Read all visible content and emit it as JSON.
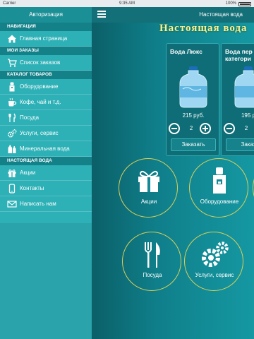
{
  "status_bar": {
    "carrier": "Carrier",
    "time": "9:35 AM",
    "battery": "100%"
  },
  "sidebar": {
    "header": "Авторизация",
    "sections": {
      "navigation": "НАВИГАЦИЯ",
      "orders": "МОИ ЗАКАЗЫ",
      "catalog": "КАТАЛОГ ТОВАРОВ",
      "company": "НАСТОЯЩАЯ ВОДА"
    },
    "items": {
      "home": "Главная страница",
      "orders_list": "Список заказов",
      "equipment": "Оборудование",
      "coffee": "Кофе, чай и т.д.",
      "dishes": "Посуда",
      "services": "Услуги, сервис",
      "mineral": "Минеральная вода",
      "promos": "Акции",
      "contacts": "Контакты",
      "write": "Написать нам"
    }
  },
  "main": {
    "title": "Настоящая вода",
    "banner": "Настоящая вода",
    "products": [
      {
        "name": "Вода Люкс",
        "price": "215 руб.",
        "qty": "2",
        "button": "Заказать"
      },
      {
        "name": "Вода пер категори",
        "price": "195 р",
        "qty": "2",
        "button": "Заказ"
      }
    ],
    "tiles": {
      "promos": "Акции",
      "equipment": "Оборудование",
      "dishes": "Посуда",
      "services": "Услуги, сервис"
    }
  },
  "colors": {
    "sidebar": "#2db0b6",
    "sidebar_header": "#1b8f96",
    "section": "#148189",
    "main": "#0f7f8a",
    "circle_border": "#d9cf5a"
  }
}
